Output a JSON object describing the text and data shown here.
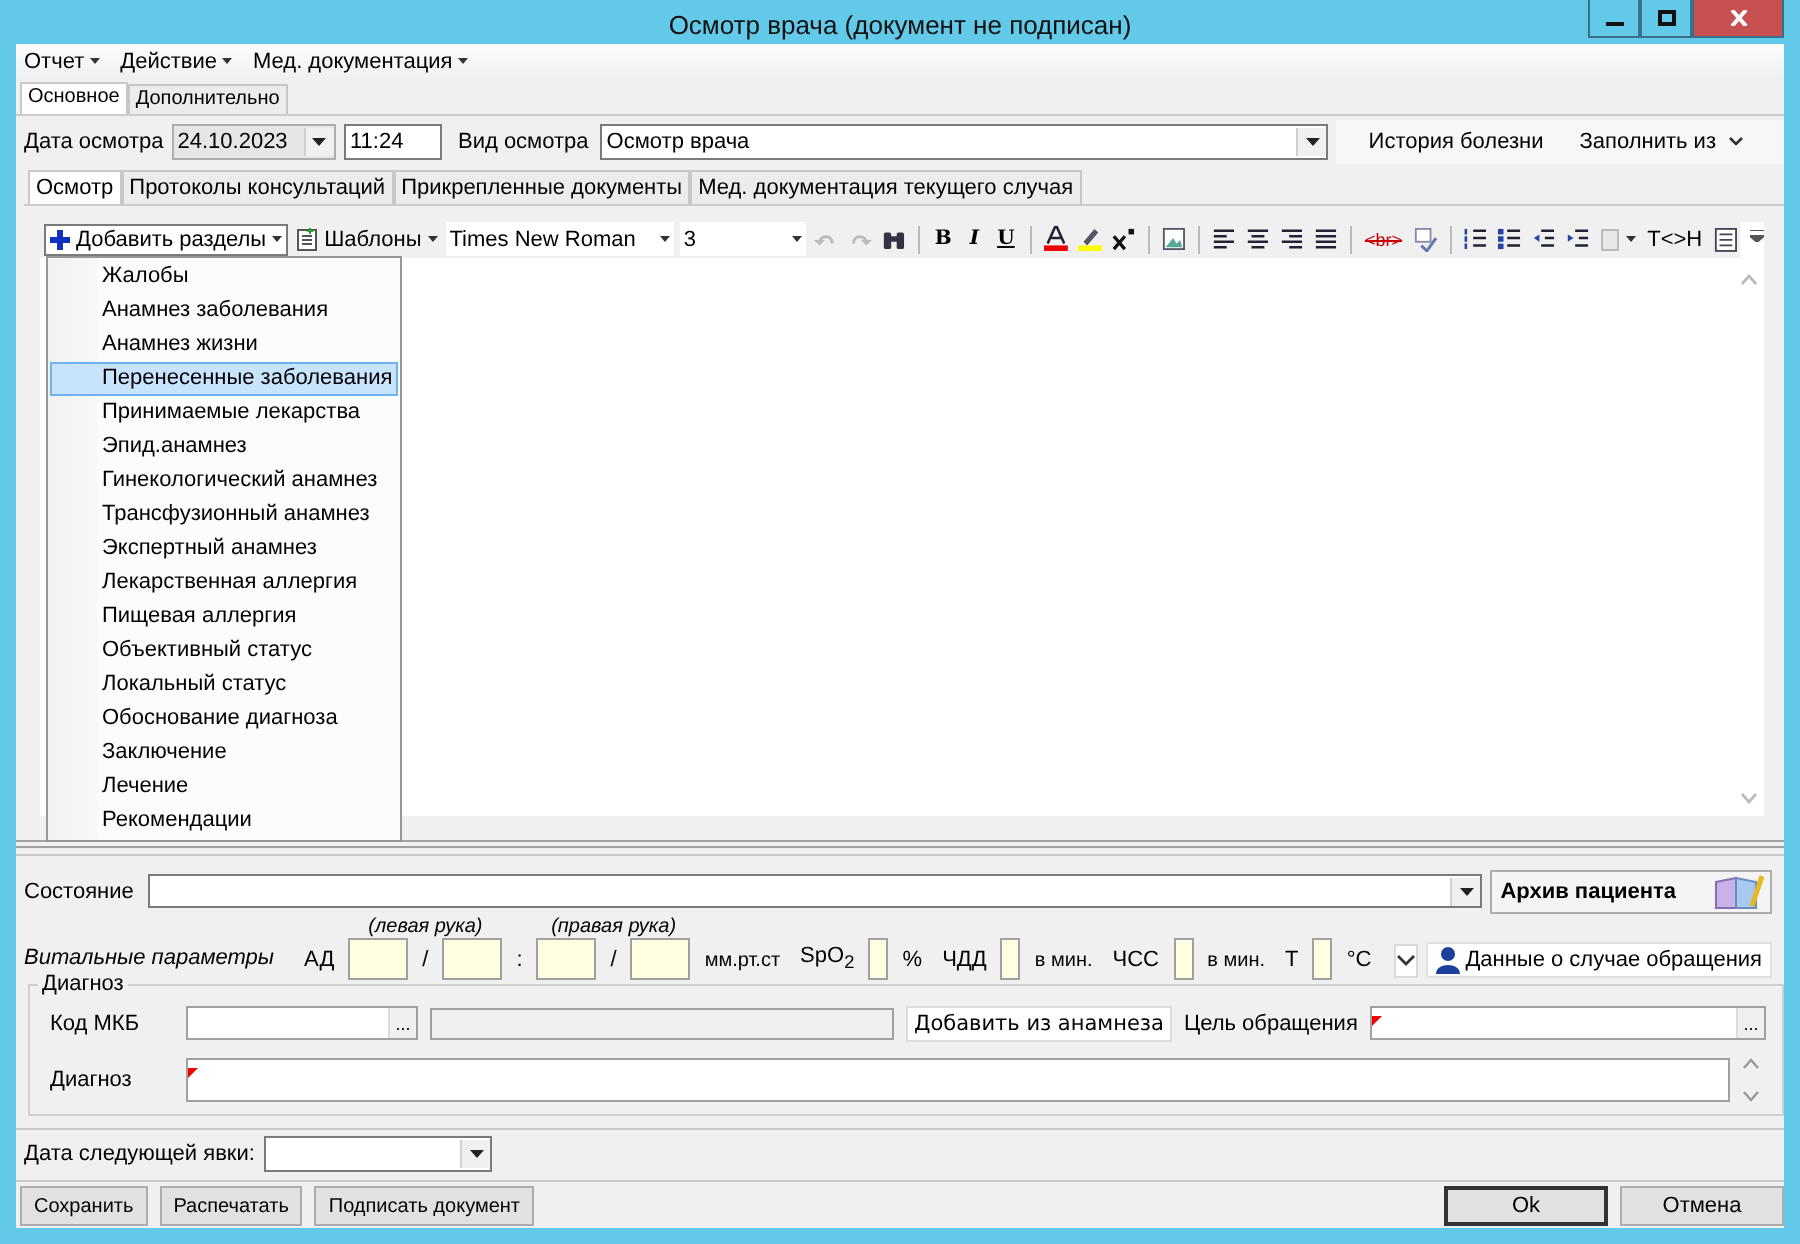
{
  "window": {
    "title": "Осмотр врача (документ не подписан)"
  },
  "menu": [
    {
      "label": "Отчет"
    },
    {
      "label": "Действие"
    },
    {
      "label": "Мед. документация"
    }
  ],
  "outer_tabs": [
    {
      "label": "Основное",
      "selected": true
    },
    {
      "label": "Дополнительно",
      "selected": false
    }
  ],
  "exam": {
    "date_label": "Дата осмотра",
    "date": "24.10.2023",
    "date_disabled": true,
    "time": "11:24",
    "type_label": "Вид осмотра",
    "type": "Осмотр врача"
  },
  "side_actions": [
    {
      "label": "История болезни",
      "dropdown": false
    },
    {
      "label": "Заполнить из",
      "dropdown": true
    }
  ],
  "inner_tabs": [
    {
      "label": "Осмотр",
      "selected": true
    },
    {
      "label": "Протоколы консультаций",
      "selected": false
    },
    {
      "label": "Прикрепленные документы",
      "selected": false
    },
    {
      "label": "Мед. документация текущего случая",
      "selected": false
    }
  ],
  "toolbar": {
    "add_sections": "Добавить разделы",
    "templates": "Шаблоны",
    "font": "Times New Roman",
    "size": "3",
    "bold": "B",
    "italic": "I",
    "underline": "U",
    "br_tag": "<br>",
    "swap": "T<>H"
  },
  "sections_menu": [
    {
      "label": "Жалобы",
      "selected": false
    },
    {
      "label": "Анамнез заболевания",
      "selected": false
    },
    {
      "label": "Анамнез жизни",
      "selected": false
    },
    {
      "label": "Перенесенные заболевания",
      "selected": true
    },
    {
      "label": "Принимаемые лекарства",
      "selected": false
    },
    {
      "label": "Эпид.анамнез",
      "selected": false
    },
    {
      "label": "Гинекологический анамнез",
      "selected": false
    },
    {
      "label": "Трансфузионный анамнез",
      "selected": false
    },
    {
      "label": "Экспертный анамнез",
      "selected": false
    },
    {
      "label": "Лекарственная аллергия",
      "selected": false
    },
    {
      "label": "Пищевая аллергия",
      "selected": false
    },
    {
      "label": "Объективный статус",
      "selected": false
    },
    {
      "label": "Локальный статус",
      "selected": false
    },
    {
      "label": "Обоснование диагноза",
      "selected": false
    },
    {
      "label": "Заключение",
      "selected": false
    },
    {
      "label": "Лечение",
      "selected": false
    },
    {
      "label": "Рекомендации",
      "selected": false
    }
  ],
  "condition": {
    "label": "Состояние",
    "archive_button": "Архив пациента"
  },
  "vitals": {
    "label": "Витальные параметры",
    "items": [
      {
        "kind": "text",
        "text": "АД"
      },
      {
        "kind": "group",
        "caption": "(левая рука)",
        "children": [
          {
            "kind": "field"
          },
          {
            "kind": "text",
            "text": "/"
          },
          {
            "kind": "field"
          }
        ]
      },
      {
        "kind": "text",
        "text": ":"
      },
      {
        "kind": "group",
        "caption": "(правая рука)",
        "children": [
          {
            "kind": "field"
          },
          {
            "kind": "text",
            "text": "/"
          },
          {
            "kind": "field"
          }
        ]
      },
      {
        "kind": "unit",
        "text": "мм.рт.ст"
      },
      {
        "kind": "text",
        "text": "SpO$_{2}$"
      },
      {
        "kind": "field"
      },
      {
        "kind": "text",
        "text": "%"
      },
      {
        "kind": "text",
        "text": "ЧДД"
      },
      {
        "kind": "field"
      },
      {
        "kind": "unit",
        "text": "в мин."
      },
      {
        "kind": "text",
        "text": "ЧСС"
      },
      {
        "kind": "field"
      },
      {
        "kind": "unit",
        "text": "в мин."
      },
      {
        "kind": "text",
        "text": "Т"
      },
      {
        "kind": "field"
      },
      {
        "kind": "text",
        "text": "°С"
      }
    ],
    "case_button": "Данные о случае обращения"
  },
  "diagnosis": {
    "legend": "Диагноз",
    "code_label": "Код МКБ",
    "add_button": "Добавить из анамнеза",
    "purpose_label": "Цель обращения",
    "purpose_required": true,
    "diagnosis_label": "Диагноз",
    "diagnosis_required": true,
    "browse": "..."
  },
  "next_visit": {
    "label": "Дата следующей явки:"
  },
  "buttons_left": [
    {
      "label": "Сохранить"
    },
    {
      "label": "Распечатать"
    },
    {
      "label": "Подписать документ"
    }
  ],
  "buttons_right": [
    {
      "label": "Ok",
      "default": true
    },
    {
      "label": "Отмена",
      "default": false
    }
  ]
}
